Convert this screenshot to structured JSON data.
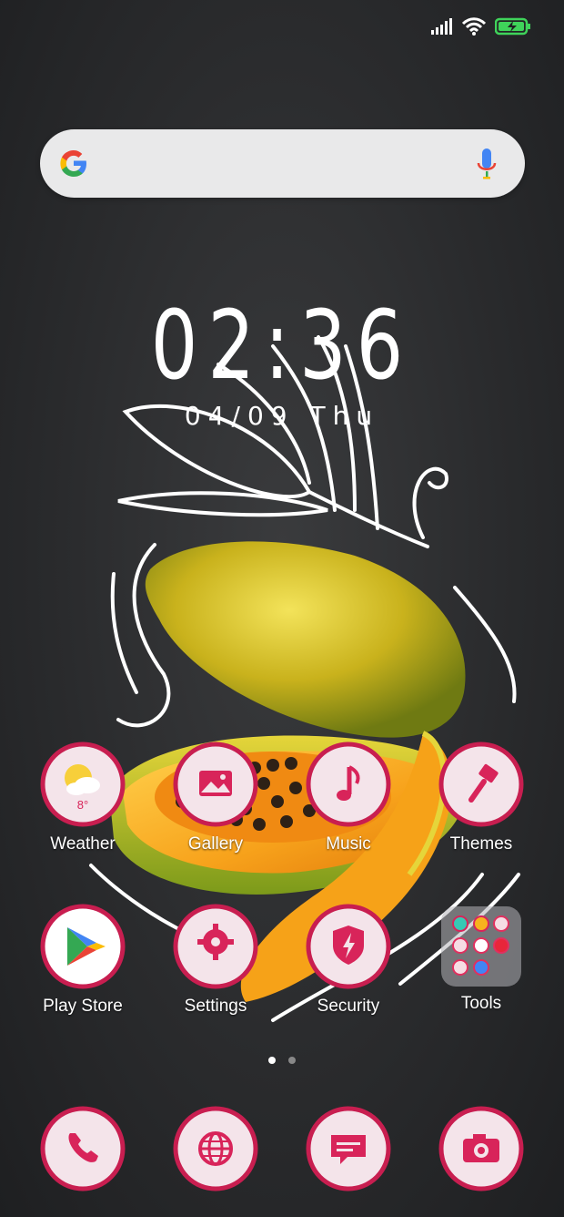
{
  "status_bar": {
    "signal_icon": "signal-bars-icon",
    "wifi_icon": "wifi-icon",
    "battery_icon": "battery-charging-icon"
  },
  "search": {
    "google_icon": "google-g-icon",
    "mic_icon": "microphone-icon"
  },
  "clock": {
    "time": "02:36",
    "date": "04/09 Thu"
  },
  "apps": [
    {
      "label": "Weather",
      "icon": "weather-icon",
      "temp": "8°"
    },
    {
      "label": "Gallery",
      "icon": "gallery-icon"
    },
    {
      "label": "Music",
      "icon": "music-icon"
    },
    {
      "label": "Themes",
      "icon": "themes-icon"
    },
    {
      "label": "Play Store",
      "icon": "play-store-icon"
    },
    {
      "label": "Settings",
      "icon": "settings-icon"
    },
    {
      "label": "Security",
      "icon": "security-icon"
    },
    {
      "label": "Tools",
      "icon": "tools-folder-icon"
    }
  ],
  "page_indicator": {
    "pages": 2,
    "active": 1
  },
  "dock": [
    {
      "icon": "phone-icon"
    },
    {
      "icon": "browser-icon"
    },
    {
      "icon": "messages-icon"
    },
    {
      "icon": "camera-icon"
    }
  ],
  "colors": {
    "accent": "#d8245a",
    "icon_bg": "#f4e4ea",
    "background": "#2a2b2d"
  }
}
